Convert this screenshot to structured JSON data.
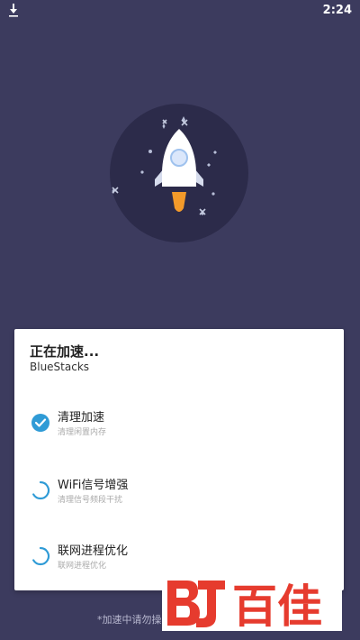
{
  "status_bar": {
    "time": "2:24",
    "download_icon": "download-icon"
  },
  "dialog": {
    "title": "正在加速...",
    "subtitle": "BlueStacks",
    "tasks": [
      {
        "label": "清理加速",
        "desc": "清理闲置内存",
        "status": "done"
      },
      {
        "label": "WiFi信号增强",
        "desc": "清理信号频段干扰",
        "status": "in-progress"
      },
      {
        "label": "联网进程优化",
        "desc": "联网进程优化",
        "status": "in-progress"
      }
    ]
  },
  "footer_note": "*加速中请勿操",
  "watermark": {
    "text": "百佳",
    "logo_text": "BJ"
  },
  "colors": {
    "background": "#3c3b5e",
    "circle": "#2c2b4a",
    "accent": "#2f9bd6",
    "flame": "#f39a2a",
    "watermark": "#e63b2e"
  }
}
